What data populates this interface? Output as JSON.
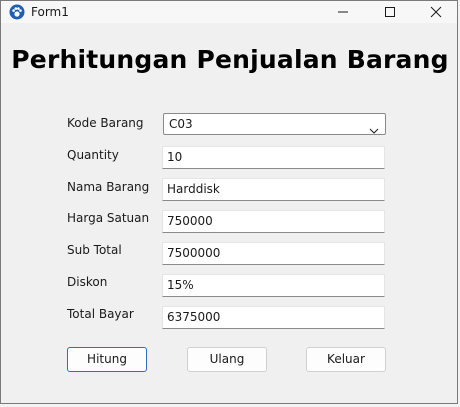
{
  "window": {
    "title": "Form1"
  },
  "form": {
    "heading": "Perhitungan Penjualan Barang",
    "fields": [
      {
        "label": "Kode Barang",
        "value": "C03"
      },
      {
        "label": "Quantity",
        "value": "10"
      },
      {
        "label": "Nama Barang",
        "value": "Harddisk"
      },
      {
        "label": "Harga Satuan",
        "value": "750000"
      },
      {
        "label": "Sub Total",
        "value": "7500000"
      },
      {
        "label": "Diskon",
        "value": "15%"
      },
      {
        "label": "Total Bayar",
        "value": "6375000"
      }
    ],
    "buttons": {
      "hitung": "Hitung",
      "ulang": "Ulang",
      "keluar": "Keluar"
    }
  },
  "colors": {
    "default_button_border": "#2e6bc6",
    "window_bg": "#f0f0f0"
  }
}
